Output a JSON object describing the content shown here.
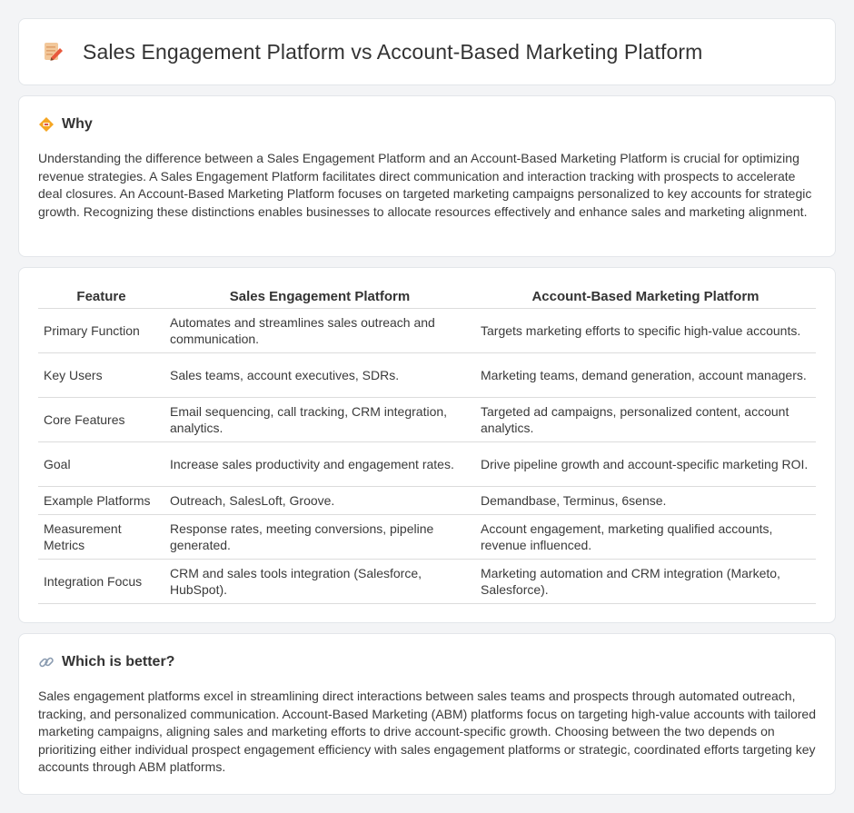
{
  "header": {
    "icon": "pencil-note-icon",
    "title": "Sales Engagement Platform vs Account-Based Marketing Platform"
  },
  "why": {
    "icon": "diamond-sign-icon",
    "title": "Why",
    "text": "Understanding the difference between a Sales Engagement Platform and an Account-Based Marketing Platform is crucial for optimizing revenue strategies. A Sales Engagement Platform facilitates direct communication and interaction tracking with prospects to accelerate deal closures. An Account-Based Marketing Platform focuses on targeted marketing campaigns personalized to key accounts for strategic growth. Recognizing these distinctions enables businesses to allocate resources effectively and enhance sales and marketing alignment."
  },
  "table": {
    "headers": [
      "Feature",
      "Sales Engagement Platform",
      "Account-Based Marketing Platform"
    ],
    "rows": [
      [
        "Primary Function",
        "Automates and streamlines sales outreach and communication.",
        "Targets marketing efforts to specific high-value accounts."
      ],
      [
        "Key Users",
        "Sales teams, account executives, SDRs.",
        "Marketing teams, demand generation, account managers."
      ],
      [
        "Core Features",
        "Email sequencing, call tracking, CRM integration, analytics.",
        "Targeted ad campaigns, personalized content, account analytics."
      ],
      [
        "Goal",
        "Increase sales productivity and engagement rates.",
        "Drive pipeline growth and account-specific marketing ROI."
      ],
      [
        "Example Platforms",
        "Outreach, SalesLoft, Groove.",
        "Demandbase, Terminus, 6sense."
      ],
      [
        "Measurement Metrics",
        "Response rates, meeting conversions, pipeline generated.",
        "Account engagement, marketing qualified accounts, revenue influenced."
      ],
      [
        "Integration Focus",
        "CRM and sales tools integration (Salesforce, HubSpot).",
        "Marketing automation and CRM integration (Marketo, Salesforce)."
      ]
    ]
  },
  "better": {
    "icon": "link-icon",
    "title": "Which is better?",
    "text": "Sales engagement platforms excel in streamlining direct interactions between sales teams and prospects through automated outreach, tracking, and personalized communication. Account-Based Marketing (ABM) platforms focus on targeting high-value accounts with tailored marketing campaigns, aligning sales and marketing efforts to drive account-specific growth. Choosing between the two depends on prioritizing either individual prospect engagement efficiency with sales engagement platforms or strategic, coordinated efforts targeting key accounts through ABM platforms."
  }
}
